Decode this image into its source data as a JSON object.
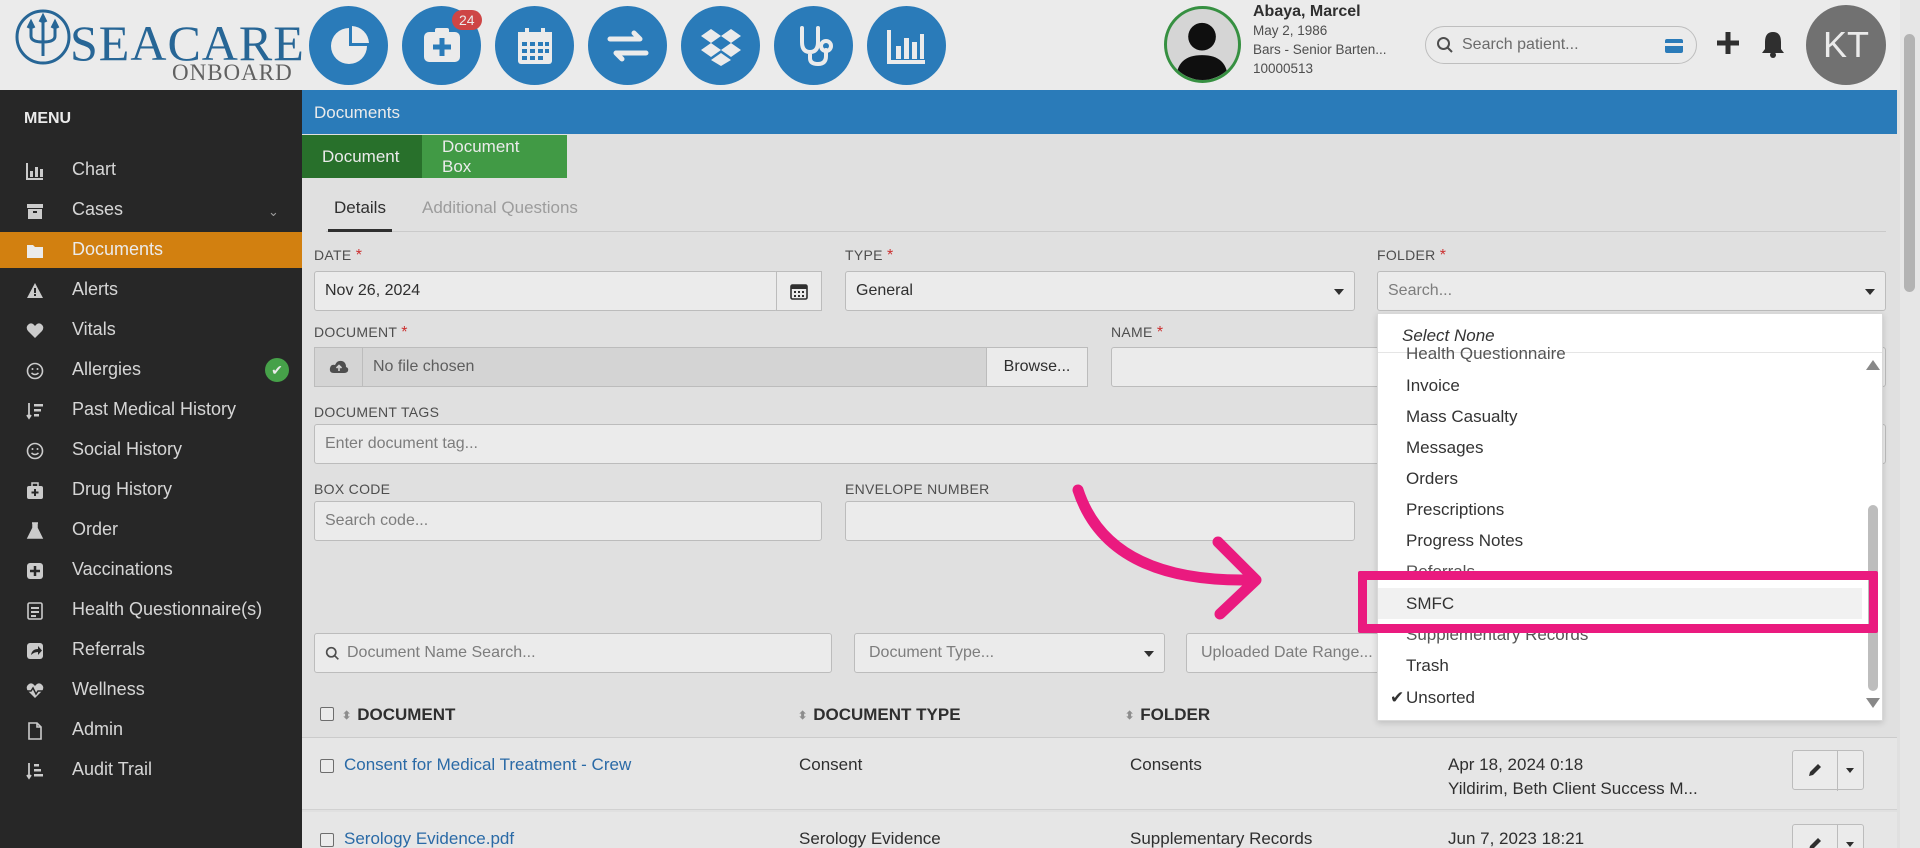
{
  "logo": {
    "brand": "SEACARE",
    "sub": "ONBOARD"
  },
  "nav": {
    "badge_count": "24",
    "buttons": [
      "pie-chart",
      "medical-plus",
      "calendar",
      "transfer",
      "dropbox",
      "stethoscope",
      "bar-chart"
    ]
  },
  "patient": {
    "name": "Abaya, Marcel",
    "dob": "May 2, 1986",
    "role": "Bars - Senior Barten...",
    "id": "10000513"
  },
  "search": {
    "placeholder": "Search patient..."
  },
  "user": {
    "initials": "KT"
  },
  "sidebar": {
    "title": "MENU",
    "items": [
      {
        "label": "Chart"
      },
      {
        "label": "Cases"
      },
      {
        "label": "Documents"
      },
      {
        "label": "Alerts"
      },
      {
        "label": "Vitals"
      },
      {
        "label": "Allergies"
      },
      {
        "label": "Past Medical History"
      },
      {
        "label": "Social History"
      },
      {
        "label": "Drug History"
      },
      {
        "label": "Order"
      },
      {
        "label": "Vaccinations"
      },
      {
        "label": "Health Questionnaire(s)"
      },
      {
        "label": "Referrals"
      },
      {
        "label": "Wellness"
      },
      {
        "label": "Admin"
      },
      {
        "label": "Audit Trail"
      }
    ]
  },
  "main": {
    "header": "Documents",
    "tabs": {
      "document": "Document",
      "box": "Document Box"
    },
    "subtabs": {
      "details": "Details",
      "additional": "Additional Questions"
    }
  },
  "form": {
    "date_label": "DATE",
    "date_value": "Nov 26, 2024",
    "type_label": "TYPE",
    "type_value": "General",
    "folder_label": "FOLDER",
    "folder_placeholder": "Search...",
    "document_label": "DOCUMENT",
    "document_value": "No file chosen",
    "browse_label": "Browse...",
    "name_label": "NAME",
    "tags_label": "DOCUMENT TAGS",
    "tags_placeholder": "Enter document tag...",
    "box_label": "BOX CODE",
    "box_placeholder": "Search code...",
    "envelope_label": "ENVELOPE NUMBER"
  },
  "filters": {
    "name_search": "Document Name Search...",
    "type": "Document Type...",
    "date_range": "Uploaded Date Range..."
  },
  "table": {
    "headers": {
      "document": "DOCUMENT",
      "type": "DOCUMENT TYPE",
      "folder": "FOLDER"
    },
    "rows": [
      {
        "document": "Consent for Medical Treatment - Crew",
        "type": "Consent",
        "folder": "Consents",
        "date": "Apr 18, 2024 0:18",
        "user": "Yildirim, Beth Client Success M..."
      },
      {
        "document": "Serology Evidence.pdf",
        "type": "Serology Evidence",
        "folder": "Supplementary Records",
        "date": "Jun 7, 2023 18:21",
        "user": ""
      }
    ]
  },
  "dropdown": {
    "select_none": "Select None",
    "options": [
      "Health Questionnaire",
      "Invoice",
      "Mass Casualty",
      "Messages",
      "Orders",
      "Prescriptions",
      "Progress Notes",
      "Referrals",
      "SMFC",
      "Supplementary Records",
      "Trash",
      "Unsorted"
    ],
    "highlighted": "SMFC",
    "checked": "Unsorted"
  },
  "colors": {
    "accent_blue": "#2e86c9",
    "active_orange": "#e48b12",
    "tab_green": "#2c7a2f",
    "highlight_pink": "#ea1a7f"
  }
}
